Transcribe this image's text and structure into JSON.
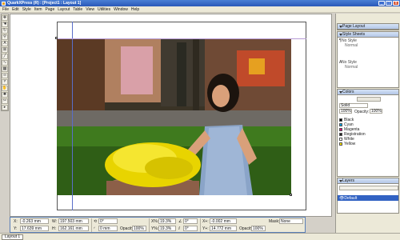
{
  "window": {
    "title": "QuarkXPress (R) : [Project1 : Layout 1]",
    "controls": [
      "minimize",
      "maximize",
      "close"
    ]
  },
  "menu": [
    "File",
    "Edit",
    "Style",
    "Item",
    "Page",
    "Layout",
    "Table",
    "View",
    "Utilities",
    "Window",
    "Help"
  ],
  "tools": [
    "item-tool",
    "content-tool",
    "rotate-tool",
    "zoom-tool",
    "text-box-tool",
    "picture-box-tool",
    "line-tool",
    "text-path-tool",
    "table-tool",
    "link-tool",
    "unlink-tool",
    "pan-tool",
    "starburst-tool",
    "scissors-tool",
    "select-point-tool"
  ],
  "measurements": {
    "x": {
      "label": "X:",
      "value": "-0.263 mm"
    },
    "y": {
      "label": "Y:",
      "value": "17.639 mm"
    },
    "w": {
      "label": "W:",
      "value": "197.503 mm"
    },
    "h": {
      "label": "H:",
      "value": "162.161 mm"
    },
    "angle1": {
      "value": "0°"
    },
    "corner": {
      "value": "0 mm"
    },
    "xpct": {
      "label": "X%:",
      "value": "19.3%"
    },
    "ypct": {
      "label": "Y%:",
      "value": "19.3%"
    },
    "xplus": {
      "label": "X+:",
      "value": "-0.002 mm"
    },
    "yplus": {
      "label": "Y+:",
      "value": "14.772 mm"
    },
    "angle2": {
      "value": "0°"
    },
    "angle3": {
      "value": "0°"
    },
    "opacity1": {
      "label": "Opacity:",
      "value": "100%"
    },
    "opacity2": {
      "label": "Opacity:",
      "value": "100%"
    },
    "mask": {
      "label": "Mask:",
      "value": "None"
    }
  },
  "status": {
    "layout_tab": "Layout 1"
  },
  "palettes": {
    "page_layout": {
      "title": "Page Layout"
    },
    "style_sheets": {
      "title": "Style Sheets",
      "paragraph": [
        {
          "label": "No Style"
        },
        {
          "label": "Normal"
        }
      ],
      "character": [
        {
          "label": "No Style"
        },
        {
          "label": "Normal"
        }
      ]
    },
    "colors": {
      "title": "Colors",
      "mode": "Solid",
      "shade": "100%",
      "opacity_label": "Opacity:",
      "opacity": "100%",
      "items": [
        {
          "name": "Black",
          "color": "#000000"
        },
        {
          "name": "Cyan",
          "color": "#00a0e0"
        },
        {
          "name": "Magenta",
          "color": "#e0007a"
        },
        {
          "name": "Registration",
          "color": "#222222"
        },
        {
          "name": "White",
          "color": "#ffffff"
        },
        {
          "name": "Yellow",
          "color": "#ffe600"
        }
      ]
    },
    "layers": {
      "title": "Layers",
      "items": [
        {
          "name": "Default",
          "active": true
        }
      ]
    }
  }
}
